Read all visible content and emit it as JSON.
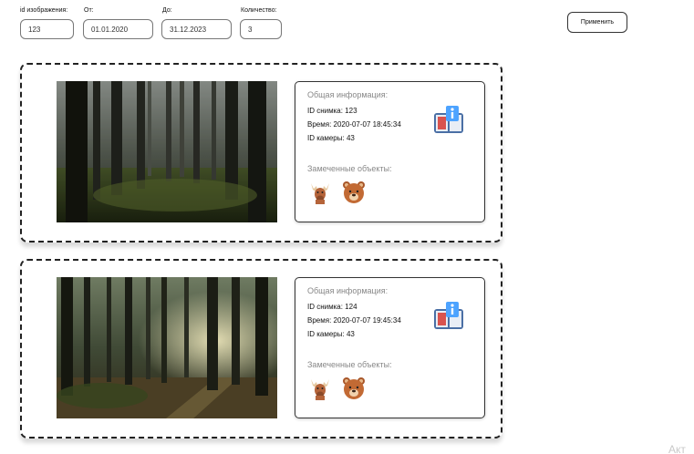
{
  "filters": {
    "image_id": {
      "label": "id изображения:",
      "value": "123"
    },
    "from": {
      "label": "От:",
      "value": "01.01.2020"
    },
    "to": {
      "label": "До:",
      "value": "31.12.2023"
    },
    "count": {
      "label": "Количество:",
      "value": "3"
    },
    "apply_label": "Применить"
  },
  "results": [
    {
      "info_title": "Общая информация:",
      "image_id_line": "ID снимка: 123",
      "time_line": "Время: 2020-07-07 18:45:34",
      "camera_line": "ID камеры: 43",
      "objects_title": "Замеченные объекты:",
      "objects": [
        "moose-icon",
        "bear-icon"
      ]
    },
    {
      "info_title": "Общая информация:",
      "image_id_line": "ID снимка: 124",
      "time_line": "Время: 2020-07-07 19:45:34",
      "camera_line": "ID камеры: 43",
      "objects_title": "Замеченные объекты:",
      "objects": [
        "moose-icon",
        "bear-icon"
      ]
    }
  ],
  "watermark": "Акт"
}
